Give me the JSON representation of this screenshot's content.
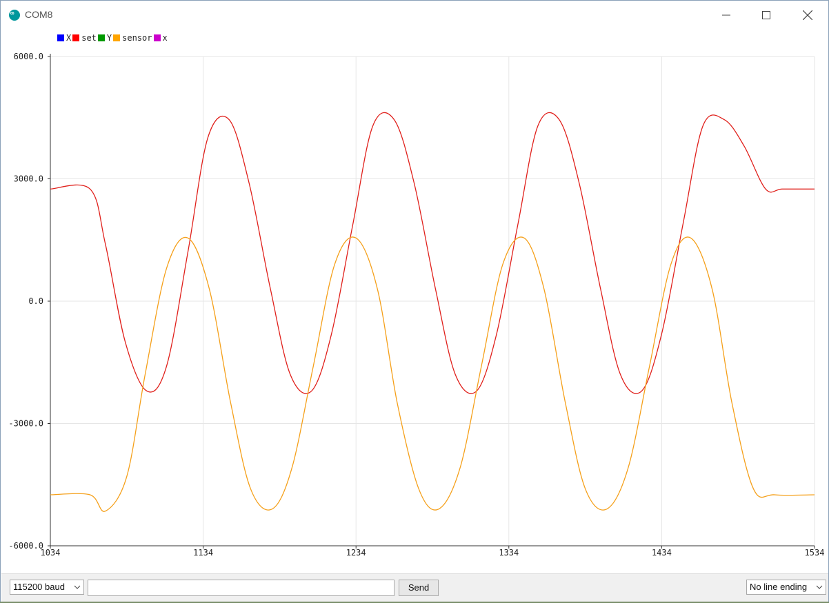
{
  "window": {
    "title": "COM8"
  },
  "legend": [
    {
      "label": "X",
      "color": "#0000ff"
    },
    {
      "label": "set",
      "color": "#ff0000"
    },
    {
      "label": "Y",
      "color": "#009900"
    },
    {
      "label": "sensor",
      "color": "#ffa500"
    },
    {
      "label": "x",
      "color": "#cc00cc"
    }
  ],
  "chart_data": {
    "type": "line",
    "title": "",
    "xlabel": "",
    "ylabel": "",
    "xlim": [
      1034,
      1534
    ],
    "ylim": [
      -6000,
      6000
    ],
    "y_ticks": [
      "6000.0",
      "3000.0",
      "0.0",
      "-3000.0",
      "-6000.0"
    ],
    "x_ticks": [
      "1034",
      "1134",
      "1234",
      "1334",
      "1434",
      "1534"
    ],
    "grid": true,
    "legend_position": "top-left",
    "series": [
      {
        "name": "set",
        "color": "#e0201b",
        "x": [
          1034,
          1060,
          1070,
          1083,
          1097,
          1110,
          1124,
          1137,
          1151,
          1164,
          1178,
          1191,
          1205,
          1218,
          1232,
          1245,
          1259,
          1272,
          1286,
          1299,
          1313,
          1326,
          1340,
          1353,
          1367,
          1380,
          1394,
          1407,
          1421,
          1434,
          1448,
          1461,
          1475,
          1488,
          1502,
          1513,
          1534
        ],
        "y": [
          2750,
          2750,
          1400,
          -1000,
          -2200,
          -1600,
          1200,
          4000,
          4450,
          2900,
          300,
          -1800,
          -2200,
          -800,
          1900,
          4300,
          4450,
          2900,
          300,
          -1800,
          -2200,
          -800,
          1900,
          4300,
          4450,
          2900,
          300,
          -1800,
          -2200,
          -800,
          1900,
          4300,
          4450,
          3800,
          2750,
          2750,
          2750
        ]
      },
      {
        "name": "sensor",
        "color": "#f5a01a",
        "x": [
          1034,
          1060,
          1070,
          1084,
          1096,
          1110,
          1124,
          1138,
          1152,
          1165,
          1179,
          1192,
          1206,
          1220,
          1234,
          1248,
          1261,
          1275,
          1288,
          1302,
          1316,
          1330,
          1344,
          1357,
          1371,
          1384,
          1398,
          1412,
          1426,
          1440,
          1453,
          1467,
          1480,
          1494,
          1508,
          1534
        ],
        "y": [
          -4750,
          -4750,
          -5150,
          -4300,
          -1800,
          800,
          1550,
          300,
          -2500,
          -4600,
          -5100,
          -4100,
          -1600,
          900,
          1550,
          300,
          -2500,
          -4600,
          -5100,
          -4100,
          -1600,
          900,
          1550,
          300,
          -2500,
          -4600,
          -5100,
          -4100,
          -1600,
          900,
          1550,
          300,
          -2500,
          -4600,
          -4750,
          -4750
        ]
      }
    ]
  },
  "bottom": {
    "baud": "115200 baud",
    "send_label": "Send",
    "input_value": "",
    "line_ending": "No line ending"
  }
}
